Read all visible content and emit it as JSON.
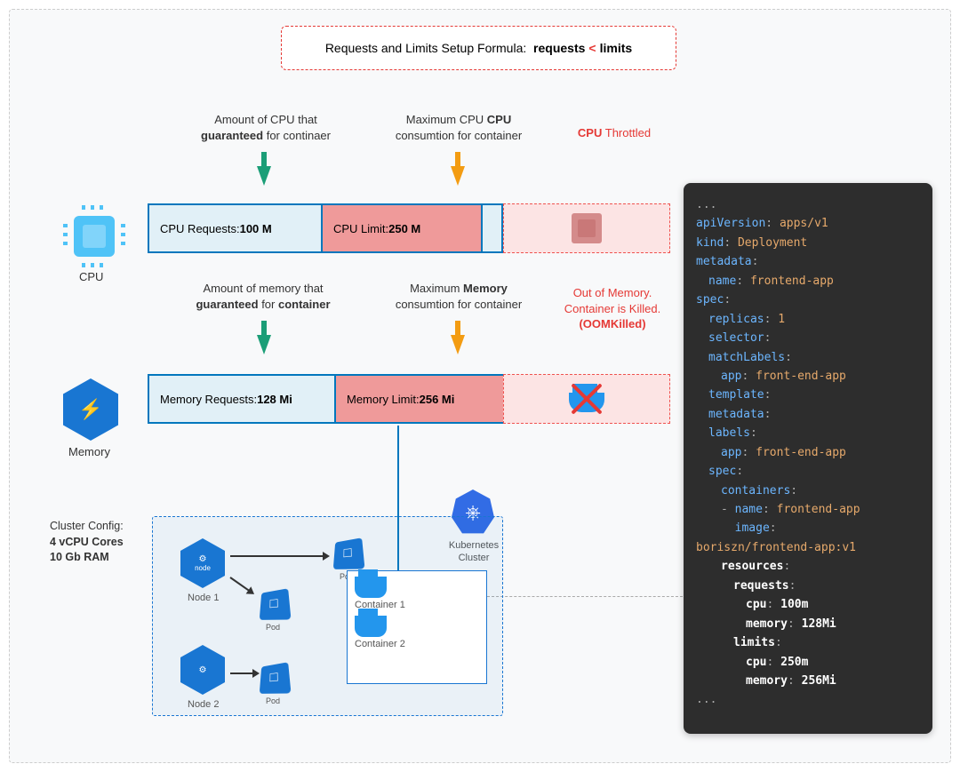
{
  "formula": {
    "prefix": "Requests and Limits Setup Formula:",
    "left": "requests",
    "op": "<",
    "right": "limits"
  },
  "cpu": {
    "req_label_line1": "Amount of CPU that",
    "req_label_line2_a": "guaranteed",
    "req_label_line2_b": "for continaer",
    "lim_label_line1": "Maximum CPU",
    "lim_label_line2": "consumtion for container",
    "throttle_a": "CPU",
    "throttle_b": " Throttled",
    "req_text": "CPU Requests: ",
    "req_val": "100 M",
    "lim_text": "CPU Limit: ",
    "lim_val": "250 M",
    "icon_label": "CPU"
  },
  "mem": {
    "req_label_line1": "Amount of memory that",
    "req_label_line2_a": "guaranteed",
    "req_label_line2_b": "for",
    "req_label_line2_c": "container",
    "lim_label_line1": "Maximum Memory",
    "lim_label_line1_b": "Memory",
    "lim_label_prefix": "Maximum ",
    "lim_label_line2": "consumtion for container",
    "oom_a": "Out of Memory.",
    "oom_b": "Container is Killed.",
    "oom_c": "(OOMKilled)",
    "req_text": "Memory Requests: ",
    "req_val": "128 Mi",
    "lim_text": "Memory Limit: ",
    "lim_val": "256 Mi",
    "icon_label": "Memory"
  },
  "cluster": {
    "cfg_title": "Cluster Config:",
    "cfg_l1": "4 vCPU Cores",
    "cfg_l2": "10 Gb RAM",
    "node1": "Node 1",
    "node2": "Node 2",
    "pod": "Pod",
    "k8s": "Kubernetes",
    "k8s2": "Cluster",
    "c1": "Container 1",
    "c2": "Container 2"
  },
  "code": {
    "apiVersion": "apps/v1",
    "kind": "Deployment",
    "meta_name": "frontend-app",
    "replicas": "1",
    "app": "front-end-app",
    "container_name": "frontend-app",
    "image": "boriszn/frontend-app:v1",
    "cpu_req": "100m",
    "mem_req": "128Mi",
    "cpu_lim": "250m",
    "mem_lim": "256Mi"
  }
}
